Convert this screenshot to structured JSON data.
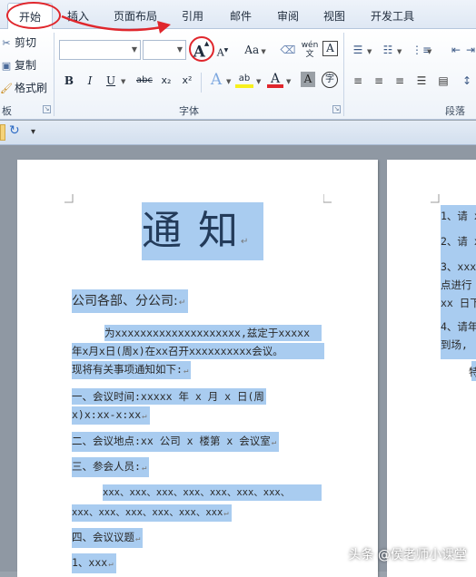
{
  "tabs": [
    "开始",
    "插入",
    "页面布局",
    "引用",
    "邮件",
    "审阅",
    "视图",
    "开发工具"
  ],
  "clipboard": {
    "cut": "剪切",
    "copy": "复制",
    "format_painter": "格式刷",
    "group_label": "板"
  },
  "font_group": {
    "label": "字体",
    "font_name": "",
    "font_size": "",
    "buttons": {
      "grow": "A",
      "shrink": "A",
      "change_case": "Aa",
      "clear": "",
      "phonetic": "wén",
      "border_char": "A",
      "bold": "B",
      "italic": "I",
      "underline": "U",
      "strike": "abc",
      "subscript": "x₂",
      "superscript": "x²",
      "text_effect": "A",
      "highlight": "ab",
      "font_color": "A",
      "shading": "A",
      "enclose": "字"
    }
  },
  "paragraph_group": {
    "label": "段落"
  },
  "document": {
    "title": "通 知",
    "greeting": "公司各部、分公司:",
    "body": [
      "为xxxxxxxxxxxxxxxxxxxx,兹定于xxxxx",
      "年x月x日(周x)在xx召开xxxxxxxxxx会议。",
      "现将有关事项通知如下:",
      "一、会议时间:xxxxx 年 x 月 x 日(周",
      "x)x:xx-x:xx",
      "二、会议地点:xx 公司 x 楼第 x 会议室",
      "三、参会人员:",
      "xxx、xxx、xxx、xxx、xxx、xxx、xxx、",
      "xxx、xxx、xxx、xxx、xxx、xxx",
      "四、会议议题",
      "1、xxx"
    ],
    "page2": [
      "1、请 x",
      "2、请 x",
      "3、xxx",
      "点进行",
      "xx 日下",
      "4、请年",
      "到场,",
      "特"
    ]
  },
  "watermark": "头条 @侯老师小课堂",
  "colors": {
    "selection": "#a9ccf0",
    "annotation": "#e0262c",
    "title": "#233b5a"
  }
}
